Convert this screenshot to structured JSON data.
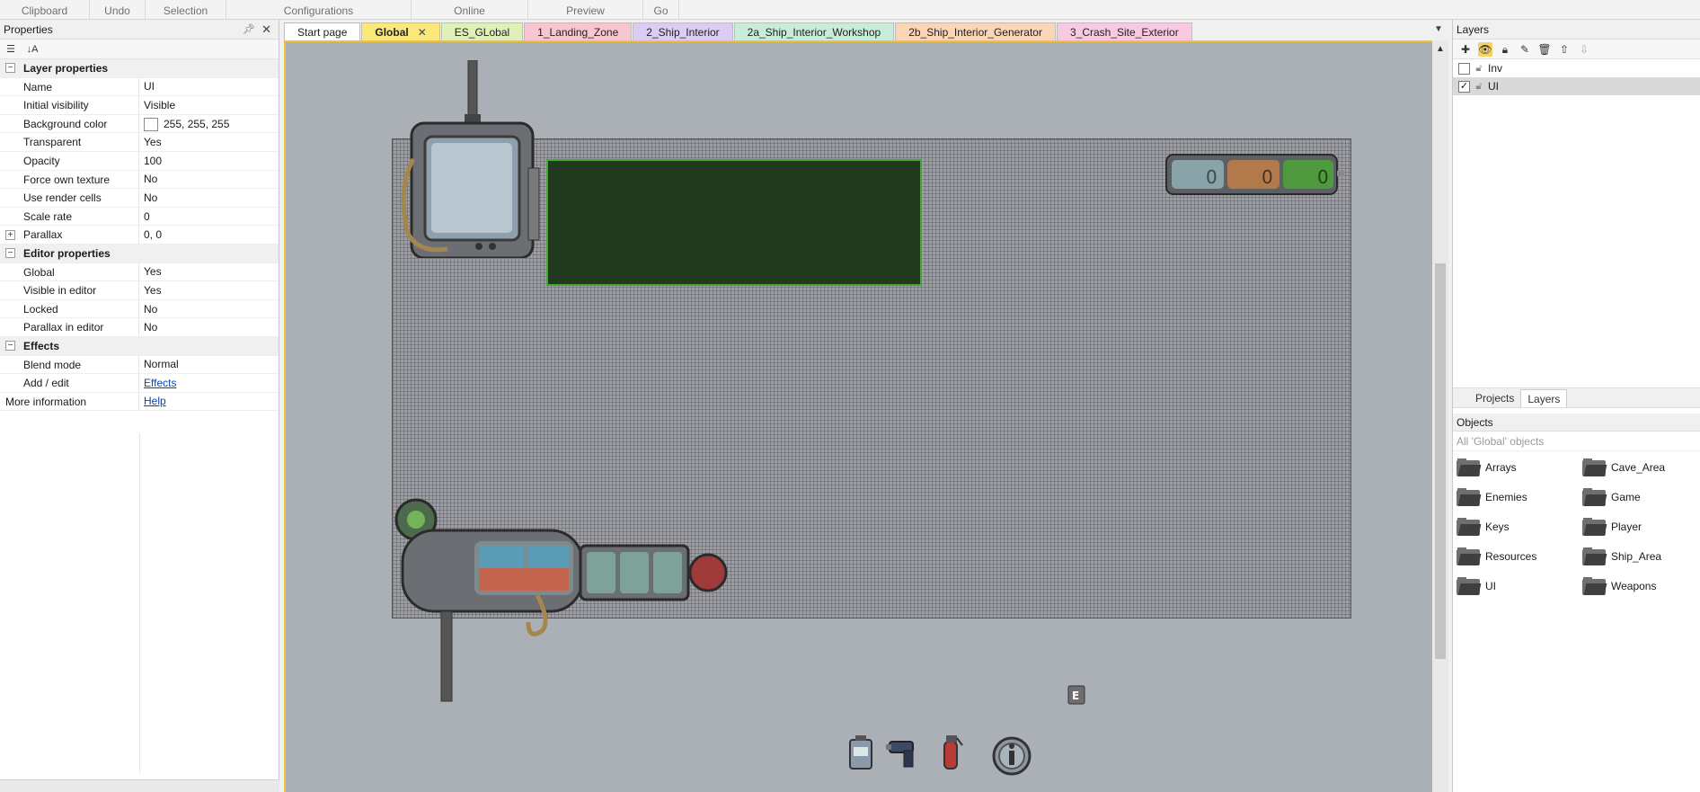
{
  "ribbon": {
    "groups": [
      "Clipboard",
      "Undo",
      "Selection",
      "Configurations",
      "Online",
      "Preview",
      "Go"
    ]
  },
  "properties": {
    "title": "Properties",
    "layer_section": "Layer properties",
    "rows": {
      "name": {
        "key": "Name",
        "val": "UI"
      },
      "initial_visibility": {
        "key": "Initial visibility",
        "val": "Visible"
      },
      "background_color": {
        "key": "Background color",
        "val": "255, 255, 255"
      },
      "transparent": {
        "key": "Transparent",
        "val": "Yes"
      },
      "opacity": {
        "key": "Opacity",
        "val": "100"
      },
      "force_own_texture": {
        "key": "Force own texture",
        "val": "No"
      },
      "use_render_cells": {
        "key": "Use render cells",
        "val": "No"
      },
      "scale_rate": {
        "key": "Scale rate",
        "val": "0"
      },
      "parallax": {
        "key": "Parallax",
        "val": "0, 0"
      },
      "global": {
        "key": "Global",
        "val": "Yes"
      },
      "visible_in_editor": {
        "key": "Visible in editor",
        "val": "Yes"
      },
      "locked": {
        "key": "Locked",
        "val": "No"
      },
      "parallax_in_editor": {
        "key": "Parallax in editor",
        "val": "No"
      },
      "blend_mode": {
        "key": "Blend mode",
        "val": "Normal"
      },
      "add_edit": {
        "key": "Add / edit",
        "val": "Effects"
      },
      "more_info": {
        "key": "More information",
        "val": "Help"
      }
    },
    "editor_section": "Editor properties",
    "effects_section": "Effects"
  },
  "tabs": [
    {
      "label": "Start page",
      "color": "#ffffff"
    },
    {
      "label": "Global",
      "color": "#fbe87a",
      "active": true
    },
    {
      "label": "ES_GLobal",
      "color": "#dff0b8"
    },
    {
      "label": "1_Landing_Zone",
      "color": "#f7c6cf"
    },
    {
      "label": "2_Ship_Interior",
      "color": "#dccbf2"
    },
    {
      "label": "2a_Ship_Interior_Workshop",
      "color": "#c8ecd8"
    },
    {
      "label": "2b_Ship_Interior_Generator",
      "color": "#fbd5b5"
    },
    {
      "label": "3_Crash_Site_Exterior",
      "color": "#f8c9df"
    }
  ],
  "editor": {
    "counters": [
      "0",
      "0",
      "0"
    ],
    "key_hint": "E"
  },
  "layers": {
    "title": "Layers",
    "items": [
      {
        "name": "Inv",
        "checked": false
      },
      {
        "name": "UI",
        "checked": true
      }
    ],
    "subtabs": [
      "Projects",
      "Layers"
    ]
  },
  "objects": {
    "title": "Objects",
    "filter": "All 'Global' objects",
    "folders": [
      "Arrays",
      "Cave_Area",
      "Enemies",
      "Game",
      "Keys",
      "Player",
      "Resources",
      "Ship_Area",
      "UI",
      "Weapons"
    ]
  }
}
